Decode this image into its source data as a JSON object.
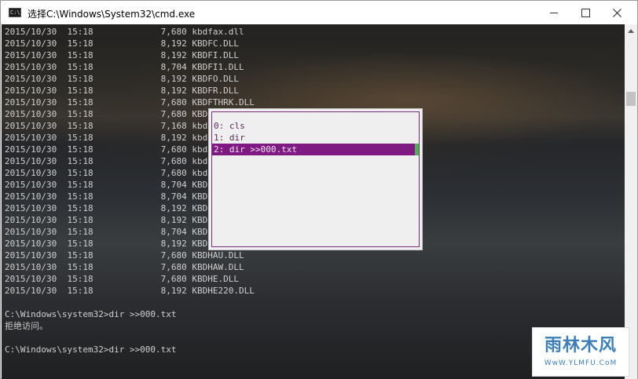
{
  "window": {
    "title": "选择C:\\Windows\\System32\\cmd.exe",
    "icon": "cmd-app-icon"
  },
  "console": {
    "lines": [
      "2015/10/30  15:18             7,680 kbdfax.dll",
      "2015/10/30  15:18             8,192 KBDFC.DLL",
      "2015/10/30  15:18             8,192 KBDFI.DLL",
      "2015/10/30  15:18             8,704 KBDFI1.DLL",
      "2015/10/30  15:18             8,192 KBDFO.DLL",
      "2015/10/30  15:18             8,192 KBDFR.DLL",
      "2015/10/30  15:18             7,680 KBDFTHRK.DLL",
      "2015/10/30  15:18             7,680 KBD",
      "2015/10/30  15:18             7,168 kbd",
      "2015/10/30  15:18             8,192 kbd",
      "2015/10/30  15:18             7,680 kbd",
      "2015/10/30  15:18             7,680 kbd",
      "2015/10/30  15:18             7,680 kbd",
      "2015/10/30  15:18             8,704 KBD",
      "2015/10/30  15:18             8,704 KBD",
      "2015/10/30  15:18             8,192 KBD",
      "2015/10/30  15:18             8,192 KBD",
      "2015/10/30  15:18             8,704 KBD",
      "2015/10/30  15:18             8,192 KBD",
      "2015/10/30  15:18             7,680 KBDHAU.DLL",
      "2015/10/30  15:18             7,680 KBDHAW.DLL",
      "2015/10/30  15:18             7,680 KBDHE.DLL",
      "2015/10/30  15:18             8,192 KBDHE220.DLL",
      "",
      "C:\\Windows\\system32>dir >>000.txt",
      "拒绝访问。",
      "",
      "C:\\Windows\\system32>dir >>000.txt"
    ]
  },
  "history_popup": {
    "items": [
      "0: cls",
      "1: dir",
      "2: dir >>000.txt"
    ],
    "selected_index": 2,
    "highlight_color": "#7e1a82"
  },
  "watermark": {
    "logo_text": "雨林木风",
    "url": "WwW.YLMFU.CoM"
  }
}
